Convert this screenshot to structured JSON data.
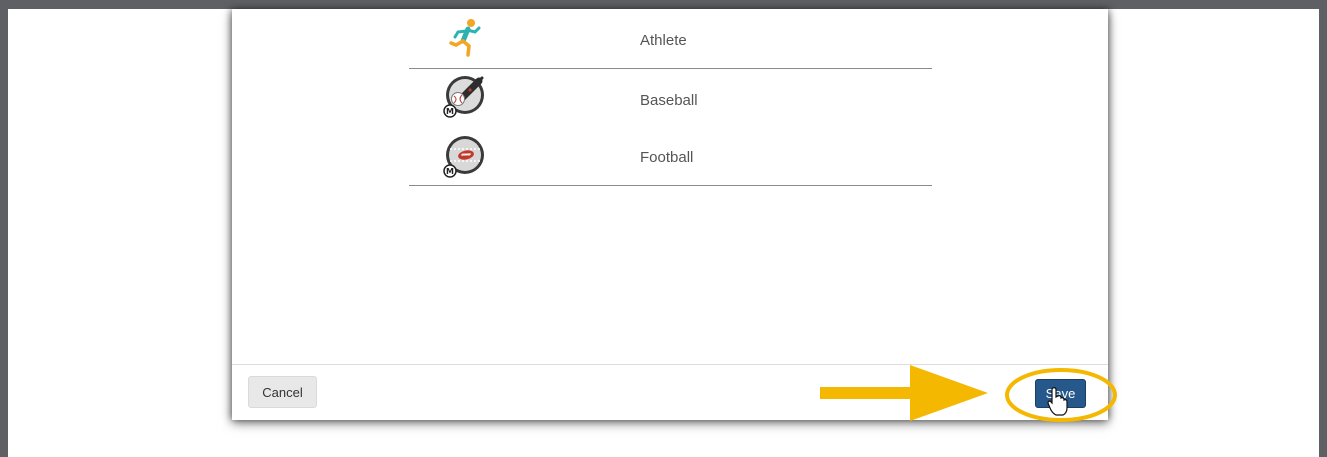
{
  "list": {
    "items": [
      {
        "label": "Athlete",
        "icon": "running-athlete-icon"
      },
      {
        "label": "Baseball",
        "icon": "baseball-bat-icon",
        "badge": "M"
      },
      {
        "label": "Football",
        "icon": "football-field-icon",
        "badge": "M"
      }
    ]
  },
  "footer": {
    "cancel_label": "Cancel",
    "save_label": "Save"
  },
  "annotation": {
    "color": "#f5b800"
  },
  "colors": {
    "frame": "#5f6063",
    "save_button": "#27588c"
  }
}
